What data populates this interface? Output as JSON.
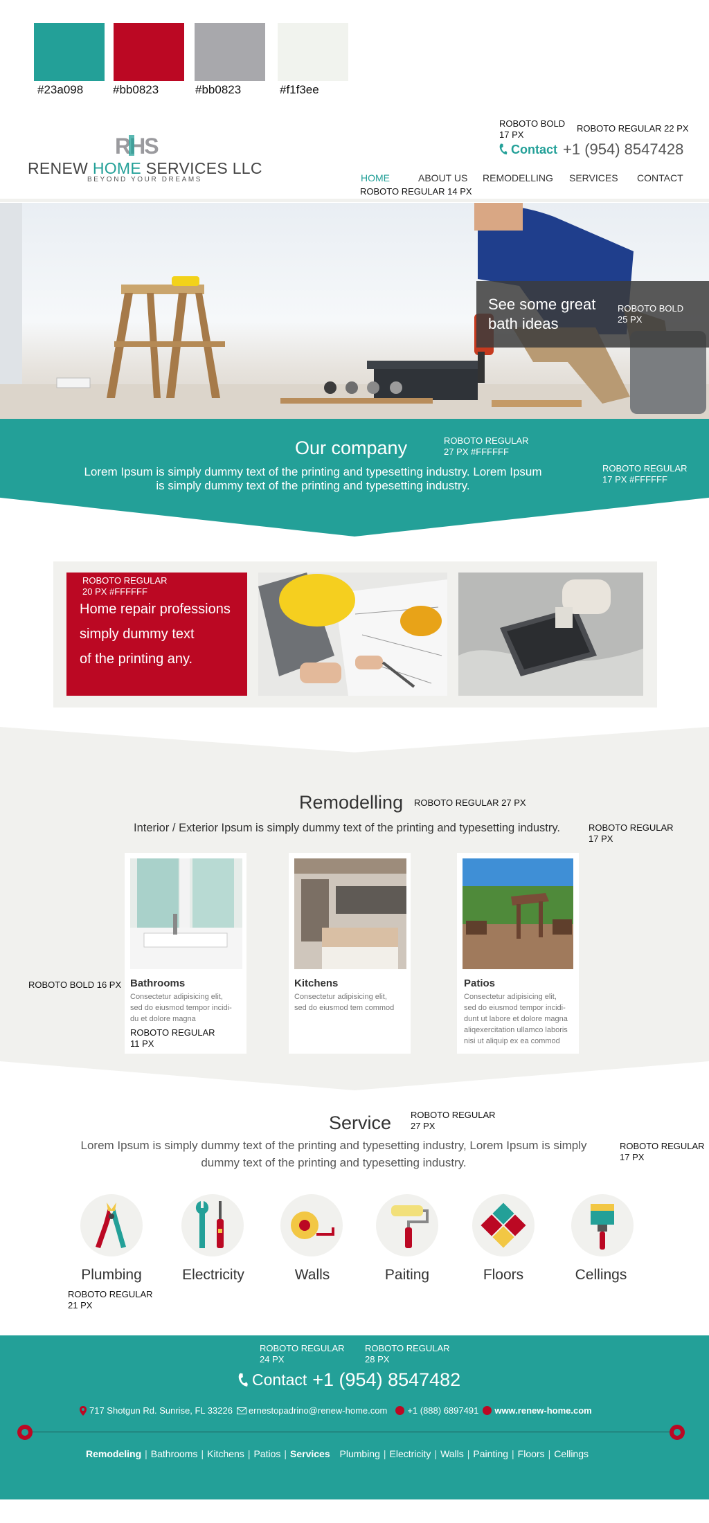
{
  "palette": [
    {
      "color": "#23a098",
      "label": "#23a098"
    },
    {
      "color": "#bb0823",
      "label": "#bb0823"
    },
    {
      "color": "#a8a8ac",
      "label": "#bb0823"
    },
    {
      "color": "#f1f3ee",
      "label": "#f1f3ee"
    }
  ],
  "annotations": {
    "contact_font": "ROBOTO BOLD\n17 PX",
    "phone_font": "ROBOTO REGULAR 22 PX",
    "nav_font": "ROBOTO REGULAR 14 PX",
    "hero_font": "ROBOTO BOLD\n25 PX",
    "company_title_font": "ROBOTO REGULAR\n27 PX #FFFFFF",
    "company_text_font": "ROBOTO REGULAR\n17 PX #FFFFFF",
    "red_card_font": "ROBOTO REGULAR\n20 PX #FFFFFF",
    "remodelling_title_font": "ROBOTO REGULAR 27 PX",
    "remodelling_text_font": "ROBOTO REGULAR\n17 PX",
    "card_title_font": "ROBOTO BOLD 16 PX",
    "card_text_font": "ROBOTO REGULAR\n11 PX",
    "service_title_font": "ROBOTO REGULAR\n27 PX",
    "service_text_font": "ROBOTO REGULAR\n17 PX",
    "service_label_font": "ROBOTO REGULAR\n21 PX",
    "footer_contact_font": "ROBOTO REGULAR\n24 PX",
    "footer_phone_font": "ROBOTO REGULAR\n28 PX"
  },
  "header": {
    "logo_mark": "RHS",
    "logo_part1": "RENEW ",
    "logo_part2": "HOME",
    "logo_part3": " SERVICES LLC",
    "tagline": "BEYOND YOUR DREAMS",
    "contact_label": "Contact",
    "phone": "+1 (954) 8547428"
  },
  "nav": {
    "items": [
      "HOME",
      "ABOUT US",
      "REMODELLING",
      "SERVICES",
      "CONTACT"
    ],
    "active_color": "#23a098"
  },
  "hero": {
    "line1": "See some great",
    "line2": "bath ideas"
  },
  "company": {
    "title": "Our company",
    "text_line1": "Lorem Ipsum is simply dummy text of the printing and typesetting industry. Lorem Ipsum",
    "text_line2": "is simply dummy text of the printing and typesetting industry."
  },
  "strip": {
    "lines": [
      "Home repair professions",
      "simply dummy text",
      "of the printing any."
    ]
  },
  "remodelling": {
    "title": "Remodelling",
    "text": "Interior / Exterior Ipsum is simply dummy text of the printing and typesetting industry.",
    "cards": [
      {
        "title": "Bathrooms",
        "text": "Consectetur adipisicing elit,\nsed do eiusmod tempor incidi-\ndu et dolore magna"
      },
      {
        "title": "Kitchens",
        "text": "Consectetur adipisicing elit,\nsed do eiusmod tem commod"
      },
      {
        "title": "Patios",
        "text": "Consectetur adipisicing elit,\nsed do eiusmod tempor incidi-\ndunt ut labore et dolore magna\naliqexercitation ullamco laboris\nnisi ut aliquip ex ea commod"
      }
    ]
  },
  "service": {
    "title": "Service",
    "text_line1": "Lorem Ipsum is simply dummy text of the printing and typesetting industry, Lorem Ipsum is simply",
    "text_line2": "dummy text of the printing and typesetting industry.",
    "items": [
      {
        "label": "Plumbing",
        "icon": "plumbing-icon"
      },
      {
        "label": "Electricity",
        "icon": "electricity-icon"
      },
      {
        "label": "Walls",
        "icon": "walls-icon"
      },
      {
        "label": "Paiting",
        "icon": "painting-icon"
      },
      {
        "label": "Floors",
        "icon": "floors-icon"
      },
      {
        "label": "Cellings",
        "icon": "ceilings-icon"
      }
    ]
  },
  "footer": {
    "contact_label": "Contact",
    "phone": "+1 (954) 8547482",
    "address": "717 Shotgun Rd. Sunrise, FL 33226",
    "email": "ernestopadrino@renew-home.com",
    "phone2": "+1 (888) 6897491",
    "website": "www.renew-home.com",
    "links_group1_title": "Remodeling",
    "links_group1": [
      "Bathrooms",
      "Kitchens",
      "Patios"
    ],
    "links_group2_title": "Services",
    "links_group2": [
      "Plumbing",
      "Electricity",
      "Walls",
      "Painting",
      "Floors",
      "Cellings"
    ]
  }
}
